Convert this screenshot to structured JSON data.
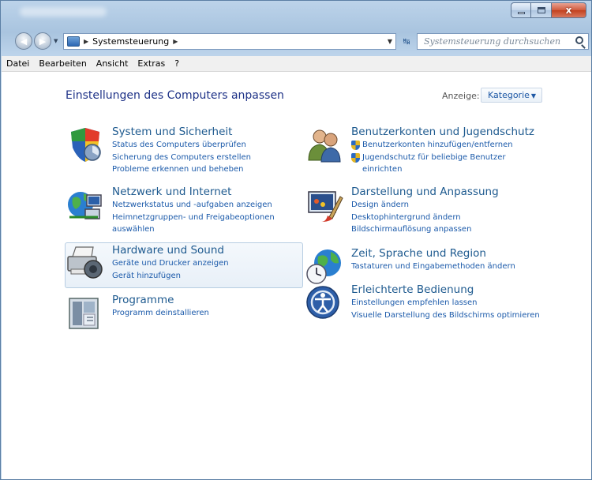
{
  "window": {
    "buttons": {
      "minimize": "–",
      "maximize": "□",
      "close": "x"
    }
  },
  "address": {
    "path": "Systemsteuerung",
    "search_placeholder": "Systemsteuerung durchsuchen"
  },
  "menu": [
    "Datei",
    "Bearbeiten",
    "Ansicht",
    "Extras",
    "?"
  ],
  "content": {
    "title": "Einstellungen des Computers anpassen",
    "view_label": "Anzeige:",
    "view_value": "Kategorie"
  },
  "categories": [
    {
      "title": "System und Sicherheit",
      "icon": "shield-security-icon",
      "links": [
        "Status des Computers überprüfen",
        "Sicherung des Computers erstellen",
        "Probleme erkennen und beheben"
      ]
    },
    {
      "title": "Netzwerk und Internet",
      "icon": "network-globe-icon",
      "links": [
        "Netzwerkstatus und -aufgaben anzeigen",
        "Heimnetzgruppen- und Freigabeoptionen",
        "auswählen"
      ]
    },
    {
      "title": "Hardware und Sound",
      "icon": "printer-speaker-icon",
      "links": [
        "Geräte und Drucker anzeigen",
        "Gerät hinzufügen"
      ]
    },
    {
      "title": "Programme",
      "icon": "programs-icon",
      "links": [
        "Programm deinstallieren"
      ]
    },
    {
      "title": "Benutzerkonten und Jugendschutz",
      "icon": "users-icon",
      "links": [
        "Benutzerkonten hinzufügen/entfernen",
        "Jugendschutz für beliebige Benutzer",
        "einrichten"
      ]
    },
    {
      "title": "Darstellung und Anpassung",
      "icon": "appearance-icon",
      "links": [
        "Design ändern",
        "Desktophintergrund ändern",
        "Bildschirmauflösung anpassen"
      ]
    },
    {
      "title": "Zeit, Sprache und Region",
      "icon": "clock-globe-icon",
      "links": [
        "Tastaturen und Eingabemethoden ändern"
      ]
    },
    {
      "title": "Erleichterte Bedienung",
      "icon": "ease-of-access-icon",
      "links": [
        "Einstellungen empfehlen lassen",
        "Visuelle Darstellung des Bildschirms optimieren"
      ]
    }
  ]
}
